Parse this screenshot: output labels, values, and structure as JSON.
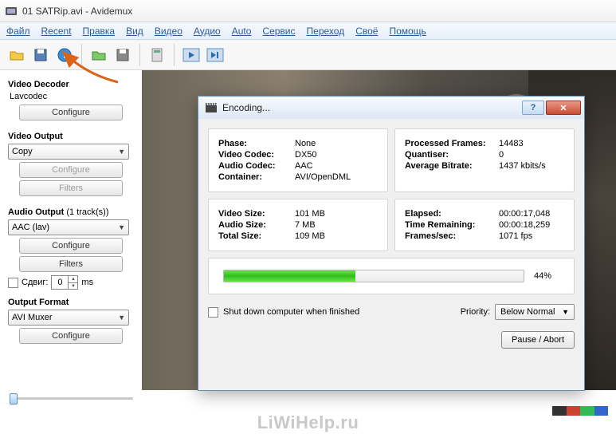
{
  "titlebar": {
    "text": "01 SATRip.avi - Avidemux"
  },
  "menu": [
    "Файл",
    "Recent",
    "Правка",
    "Вид",
    "Видео",
    "Аудио",
    "Auto",
    "Сервис",
    "Переход",
    "Своё",
    "Помощь"
  ],
  "left": {
    "decoder_head": "Video Decoder",
    "decoder_name": "Lavcodec",
    "configure": "Configure",
    "video_output_head": "Video Output",
    "video_output_sel": "Copy",
    "filters": "Filters",
    "audio_output_head": "Audio Output",
    "audio_output_tracks": "(1 track(s))",
    "audio_output_sel": "AAC (lav)",
    "shift_label": "Сдвиг:",
    "shift_val": "0",
    "shift_unit": "ms",
    "output_format_head": "Output Format",
    "output_format_sel": "AVI Muxer"
  },
  "dialog": {
    "title": "Encoding...",
    "phase_k": "Phase:",
    "phase_v": "None",
    "vcodec_k": "Video Codec:",
    "vcodec_v": "DX50",
    "acodec_k": "Audio Codec:",
    "acodec_v": "AAC",
    "container_k": "Container:",
    "container_v": "AVI/OpenDML",
    "pframes_k": "Processed Frames:",
    "pframes_v": "14483",
    "quant_k": "Quantiser:",
    "quant_v": "0",
    "abitrate_k": "Average Bitrate:",
    "abitrate_v": "1437 kbits/s",
    "vsize_k": "Video Size:",
    "vsize_v": "101 MB",
    "asize_k": "Audio Size:",
    "asize_v": "7 MB",
    "tsize_k": "Total Size:",
    "tsize_v": "109 MB",
    "elapsed_k": "Elapsed:",
    "elapsed_v": "00:00:17,048",
    "remain_k": "Time Remaining:",
    "remain_v": "00:00:18,259",
    "fps_k": "Frames/sec:",
    "fps_v": "1071 fps",
    "pct": "44%",
    "shutdown": "Shut down computer when finished",
    "priority_label": "Priority:",
    "priority_sel": "Below Normal",
    "pause": "Pause / Abort"
  },
  "watermark": "LiWiHelp.ru"
}
